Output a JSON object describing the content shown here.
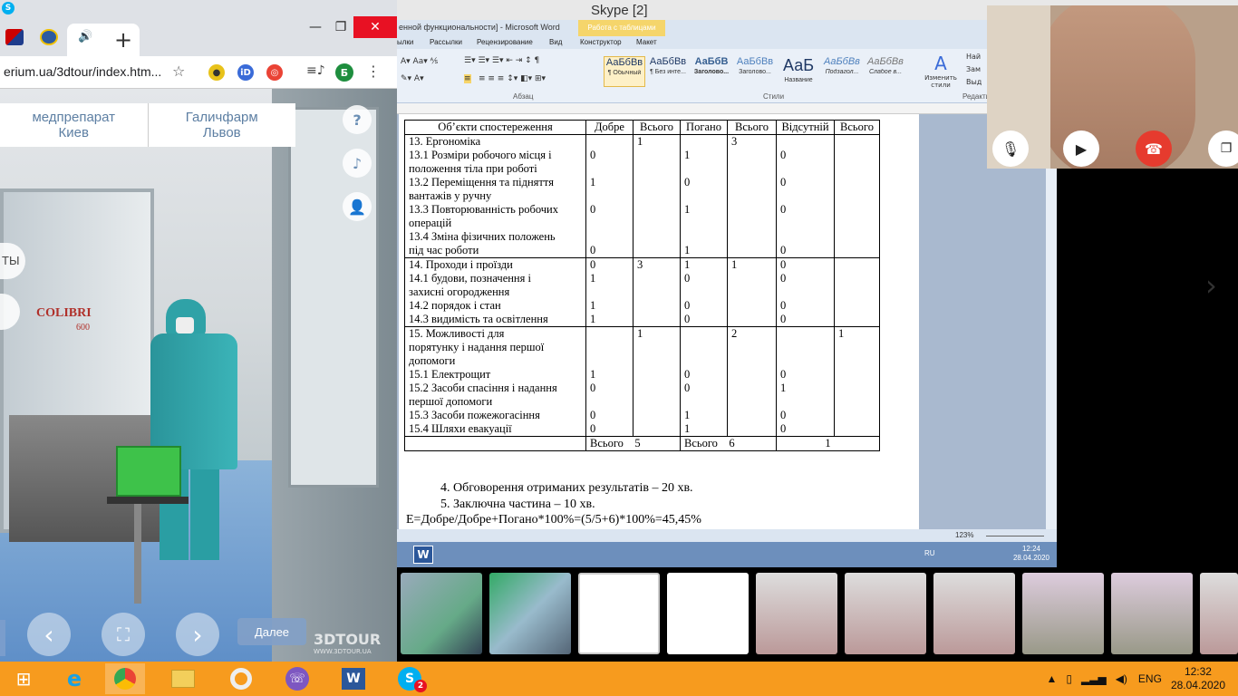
{
  "skype": {
    "title": "Skype [2]"
  },
  "chrome": {
    "url": "erium.ua/3dtour/index.htm...",
    "profile_initial": "Б",
    "tab_active_glyph": "🔊",
    "tab_new": "+",
    "win_minimize": "—",
    "win_maximize": "❐",
    "win_close": "✕"
  },
  "tour": {
    "companies": [
      {
        "line1": "медпрепарат",
        "line2": "Киев"
      },
      {
        "line1": "Галичфарм",
        "line2": "Львов"
      }
    ],
    "side_label": "ТЫ",
    "next_button": "Далее",
    "logo": "3DTOUR",
    "logo_url": "WWW.3DTOUR.UA",
    "machine_brand": "COLIBRI",
    "machine_model": "600"
  },
  "word": {
    "title": "енной функциональности] - Microsoft Word",
    "table_tools": "Работа с таблицами",
    "ribbon_tabs": [
      "ылки",
      "Рассылки",
      "Рецензирование",
      "Вид",
      "Конструктор",
      "Макет"
    ],
    "styles": [
      {
        "sample": "АаБбВв",
        "name": "¶ Обычный"
      },
      {
        "sample": "АаБбВв",
        "name": "¶ Без инте..."
      },
      {
        "sample": "АаБбВ",
        "name": "Заголово..."
      },
      {
        "sample": "АаБбВв",
        "name": "Заголово..."
      },
      {
        "sample": "АаБ",
        "name": "Название"
      },
      {
        "sample": "АаБбВв",
        "name": "Подзагол..."
      },
      {
        "sample": "АаБбВв",
        "name": "Слабое в..."
      }
    ],
    "change_styles": "Изменить стили",
    "group_paragraph": "Абзац",
    "group_styles": "Стили",
    "group_edit": "Редакти",
    "find_items": [
      "Най",
      "Зам",
      "Выд"
    ],
    "zoom": "123%",
    "lang": "RU",
    "time": "12:24",
    "date": "28.04.2020"
  },
  "doc_table": {
    "headers": [
      "Об’єкти спостереження",
      "Добре",
      "Всього",
      "Погано",
      "Всього",
      "Відсутній",
      "Всього"
    ],
    "groups": [
      {
        "items": [
          "13.     Ергономіка",
          "13.1    Розміри робочого місця і",
          "положення тіла при роботі",
          "13.2    Переміщення та підняття",
          "вантажів  у ручну",
          "13.3    Повторюванність робочих",
          "операцій",
          "13.4    Зміна фізичних положень",
          "під час роботи"
        ],
        "good": [
          "",
          "0",
          "",
          "1",
          "",
          "0",
          "",
          "",
          "0"
        ],
        "good_total": [
          "1"
        ],
        "bad": [
          "",
          "1",
          "",
          "0",
          "",
          "1",
          "",
          "",
          "1"
        ],
        "bad_total": [
          "3"
        ],
        "absent": [
          "",
          "0",
          "",
          "0",
          "",
          "0",
          "",
          "",
          "0"
        ],
        "absent_total": [
          ""
        ]
      },
      {
        "items": [
          "14.     Проходи і проїзди",
          "14.1    будови,   позначення   і",
          "захисні огородження",
          "14.2    порядок і стан",
          "14.3    видимість та освітлення"
        ],
        "good": [
          "0",
          "1",
          "",
          "1",
          "1"
        ],
        "good_total": [
          "3"
        ],
        "bad": [
          "1",
          "0",
          "",
          "0",
          "0"
        ],
        "bad_total": [
          "1"
        ],
        "absent": [
          "0",
          "0",
          "",
          "0",
          "0"
        ],
        "absent_total": [
          ""
        ]
      },
      {
        "items": [
          "15.     Можливості              для",
          "порятунку   і   надання   першої",
          "допомоги",
          "15.1    Електрощит",
          "15.2    Засоби спасіння і надання",
          "першої допомоги",
          "15.3    Засоби пожежогасіння",
          "15.4    Шляхи евакуації"
        ],
        "good": [
          "",
          "",
          "",
          "1",
          "0",
          "",
          "0",
          "0"
        ],
        "good_total": [
          "1"
        ],
        "bad": [
          "",
          "",
          "",
          "0",
          "0",
          "",
          "1",
          "1"
        ],
        "bad_total": [
          "2"
        ],
        "absent": [
          "",
          "",
          "",
          "0",
          "1",
          "",
          "0",
          "0"
        ],
        "absent_total": [
          "1"
        ]
      }
    ],
    "total_row": {
      "good_label": "Всього",
      "good_value": "5",
      "bad_label": "Всього",
      "bad_value": "6",
      "absent_value": "1"
    }
  },
  "doc_text": [
    "4. Обговорення отриманих результатів – 20 хв.",
    "5. Заключна частина – 10 хв.",
    "Е=Добре/Добре+Погано*100%=(5/5+6)*100%=45,45%"
  ],
  "taskbar": {
    "lang": "ENG",
    "time": "12:32",
    "date": "28.04.2020",
    "skype_badge": "2"
  }
}
